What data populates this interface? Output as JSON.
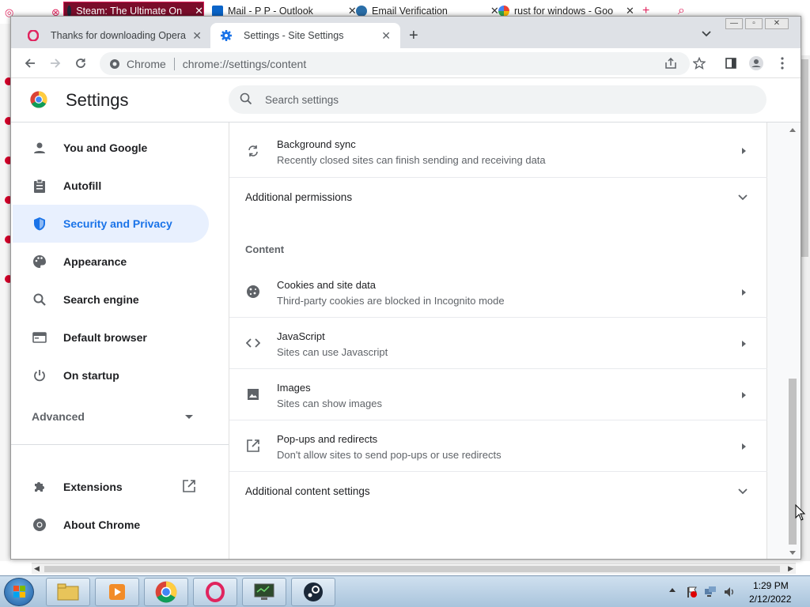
{
  "background_tabs": {
    "tab1": "Steam: The Ultimate On",
    "tab2": "Mail - P P - Outlook",
    "tab3": "Email Verification",
    "tab4": "rust for windows - Goo"
  },
  "tabs": {
    "tab1": {
      "title": "Thanks for downloading Opera"
    },
    "tab2": {
      "title": "Settings - Site Settings"
    }
  },
  "omnibox": {
    "site_chip": "Chrome",
    "url": "chrome://settings/content"
  },
  "settings": {
    "title": "Settings",
    "search_placeholder": "Search settings"
  },
  "sidebar": {
    "items": [
      {
        "label": "You and Google",
        "icon": "person-icon"
      },
      {
        "label": "Autofill",
        "icon": "clipboard-icon"
      },
      {
        "label": "Security and Privacy",
        "icon": "shield-icon",
        "selected": true
      },
      {
        "label": "Appearance",
        "icon": "palette-icon"
      },
      {
        "label": "Search engine",
        "icon": "search-icon"
      },
      {
        "label": "Default browser",
        "icon": "browser-icon"
      },
      {
        "label": "On startup",
        "icon": "power-icon"
      }
    ],
    "advanced": "Advanced",
    "extensions": "Extensions",
    "about": "About Chrome"
  },
  "content": {
    "background_sync": {
      "title": "Background sync",
      "subtitle": "Recently closed sites can finish sending and receiving data"
    },
    "additional_permissions": "Additional permissions",
    "heading": "Content",
    "cookies": {
      "title": "Cookies and site data",
      "subtitle": "Third-party cookies are blocked in Incognito mode"
    },
    "javascript": {
      "title": "JavaScript",
      "subtitle": "Sites can use Javascript"
    },
    "images": {
      "title": "Images",
      "subtitle": "Sites can show images"
    },
    "popups": {
      "title": "Pop-ups and redirects",
      "subtitle": "Don't allow sites to send pop-ups or use redirects"
    },
    "additional_content": "Additional content settings"
  },
  "taskbar": {
    "time": "1:29 PM",
    "date": "2/12/2022"
  },
  "colors": {
    "accent": "#1a73e8",
    "selected_bg": "#e8f0fe",
    "opera_red": "#e0245e"
  }
}
